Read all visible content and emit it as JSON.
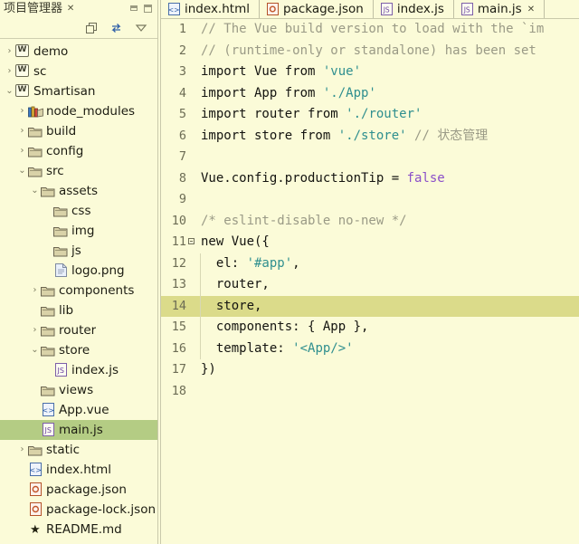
{
  "left_panel": {
    "tab_label": "项目管理器",
    "tab_close": "✕",
    "window_buttons": {
      "minimize": "minimize-icon",
      "maximize": "maximize-icon"
    },
    "toolbar": {
      "collapse_all": "collapse-all-icon",
      "link_with_editor": "link-with-editor-icon",
      "view_menu": "view-menu-icon"
    },
    "tree": [
      {
        "label": "demo",
        "indent": 0,
        "twisty": "›",
        "icon": "project-icon",
        "icon_text": "W",
        "selected": false
      },
      {
        "label": "sc",
        "indent": 0,
        "twisty": "›",
        "icon": "project-icon",
        "icon_text": "W",
        "selected": false
      },
      {
        "label": "Smartisan",
        "indent": 0,
        "twisty": "⌄",
        "icon": "project-icon",
        "icon_text": "W",
        "selected": false
      },
      {
        "label": "node_modules",
        "indent": 1,
        "twisty": "›",
        "icon": "books-icon",
        "icon_text": "",
        "selected": false
      },
      {
        "label": "build",
        "indent": 1,
        "twisty": "›",
        "icon": "folder-icon",
        "icon_text": "",
        "selected": false
      },
      {
        "label": "config",
        "indent": 1,
        "twisty": "›",
        "icon": "folder-icon",
        "icon_text": "",
        "selected": false
      },
      {
        "label": "src",
        "indent": 1,
        "twisty": "⌄",
        "icon": "folder-icon",
        "icon_text": "",
        "selected": false
      },
      {
        "label": "assets",
        "indent": 2,
        "twisty": "⌄",
        "icon": "folder-icon",
        "icon_text": "",
        "selected": false
      },
      {
        "label": "css",
        "indent": 3,
        "twisty": "",
        "icon": "folder-icon",
        "icon_text": "",
        "selected": false
      },
      {
        "label": "img",
        "indent": 3,
        "twisty": "",
        "icon": "folder-icon",
        "icon_text": "",
        "selected": false
      },
      {
        "label": "js",
        "indent": 3,
        "twisty": "",
        "icon": "folder-icon",
        "icon_text": "",
        "selected": false
      },
      {
        "label": "logo.png",
        "indent": 3,
        "twisty": "",
        "icon": "file-icon",
        "icon_text": "",
        "selected": false
      },
      {
        "label": "components",
        "indent": 2,
        "twisty": "›",
        "icon": "folder-icon",
        "icon_text": "",
        "selected": false
      },
      {
        "label": "lib",
        "indent": 2,
        "twisty": "",
        "icon": "folder-icon",
        "icon_text": "",
        "selected": false
      },
      {
        "label": "router",
        "indent": 2,
        "twisty": "›",
        "icon": "folder-icon",
        "icon_text": "",
        "selected": false
      },
      {
        "label": "store",
        "indent": 2,
        "twisty": "⌄",
        "icon": "folder-icon",
        "icon_text": "",
        "selected": false
      },
      {
        "label": "index.js",
        "indent": 3,
        "twisty": "",
        "icon": "js-icon",
        "icon_text": "",
        "selected": false
      },
      {
        "label": "views",
        "indent": 2,
        "twisty": "",
        "icon": "folder-icon",
        "icon_text": "",
        "selected": false
      },
      {
        "label": "App.vue",
        "indent": 2,
        "twisty": "",
        "icon": "vue-icon",
        "icon_text": "",
        "selected": false
      },
      {
        "label": "main.js",
        "indent": 2,
        "twisty": "",
        "icon": "js-icon",
        "icon_text": "",
        "selected": true
      },
      {
        "label": "static",
        "indent": 1,
        "twisty": "›",
        "icon": "folder-icon",
        "icon_text": "",
        "selected": false
      },
      {
        "label": "index.html",
        "indent": 1,
        "twisty": "",
        "icon": "html-icon",
        "icon_text": "",
        "selected": false
      },
      {
        "label": "package.json",
        "indent": 1,
        "twisty": "",
        "icon": "json-icon",
        "icon_text": "",
        "selected": false
      },
      {
        "label": "package-lock.json",
        "indent": 1,
        "twisty": "",
        "icon": "json-icon",
        "icon_text": "",
        "selected": false
      },
      {
        "label": "README.md",
        "indent": 1,
        "twisty": "",
        "icon": "star-icon",
        "icon_text": "★",
        "selected": false
      }
    ]
  },
  "editor": {
    "tabs": [
      {
        "label": "index.html",
        "icon": "html-icon",
        "active": false,
        "close": ""
      },
      {
        "label": "package.json",
        "icon": "json-icon",
        "active": false,
        "close": ""
      },
      {
        "label": "index.js",
        "icon": "js-icon",
        "active": false,
        "close": ""
      },
      {
        "label": "main.js",
        "icon": "js-icon",
        "active": true,
        "close": "✕"
      }
    ],
    "highlight_line": 14,
    "lines": [
      {
        "n": "1",
        "fold": false,
        "text": "// The Vue build version to load with the `im",
        "cls": "c-comment"
      },
      {
        "n": "2",
        "fold": false,
        "text": "// (runtime-only or standalone) has been set",
        "cls": "c-comment"
      },
      {
        "n": "3",
        "fold": false,
        "text": "import Vue from 'vue'",
        "cls": "mix-import-vue"
      },
      {
        "n": "4",
        "fold": false,
        "text": "import App from './App'",
        "cls": "mix-import-app"
      },
      {
        "n": "5",
        "fold": false,
        "text": "import router from './router'",
        "cls": "mix-import-router"
      },
      {
        "n": "6",
        "fold": false,
        "text": "import store from './store' // 状态管理",
        "cls": "mix-import-store"
      },
      {
        "n": "7",
        "fold": false,
        "text": "",
        "cls": "c-plain"
      },
      {
        "n": "8",
        "fold": false,
        "text": "Vue.config.productionTip = false",
        "cls": "mix-config"
      },
      {
        "n": "9",
        "fold": false,
        "text": "",
        "cls": "c-plain"
      },
      {
        "n": "10",
        "fold": false,
        "text": "/* eslint-disable no-new */",
        "cls": "c-comment"
      },
      {
        "n": "11",
        "fold": true,
        "text": "new Vue({",
        "cls": "c-plain"
      },
      {
        "n": "12",
        "fold": false,
        "text": "  el: '#app',",
        "cls": "mix-el"
      },
      {
        "n": "13",
        "fold": false,
        "text": "  router,",
        "cls": "c-plain"
      },
      {
        "n": "14",
        "fold": false,
        "text": "  store,",
        "cls": "c-plain"
      },
      {
        "n": "15",
        "fold": false,
        "text": "  components: { App },",
        "cls": "c-plain"
      },
      {
        "n": "16",
        "fold": false,
        "text": "  template: '<App/>'",
        "cls": "mix-template"
      },
      {
        "n": "17",
        "fold": false,
        "text": "})",
        "cls": "c-plain"
      },
      {
        "n": "18",
        "fold": false,
        "text": "",
        "cls": "c-plain"
      }
    ],
    "code_tokens": [
      [
        {
          "t": "// The Vue build version to load with the `im",
          "c": "c-comment"
        }
      ],
      [
        {
          "t": "// (runtime-only or standalone) has been set",
          "c": "c-comment"
        }
      ],
      [
        {
          "t": "import Vue from ",
          "c": "c-plain"
        },
        {
          "t": "'vue'",
          "c": "c-string"
        }
      ],
      [
        {
          "t": "import App from ",
          "c": "c-plain"
        },
        {
          "t": "'./App'",
          "c": "c-string"
        }
      ],
      [
        {
          "t": "import router from ",
          "c": "c-plain"
        },
        {
          "t": "'./router'",
          "c": "c-string"
        }
      ],
      [
        {
          "t": "import store from ",
          "c": "c-plain"
        },
        {
          "t": "'./store'",
          "c": "c-string"
        },
        {
          "t": " ",
          "c": "c-plain"
        },
        {
          "t": "// ",
          "c": "c-comment"
        },
        {
          "t": "状态管理",
          "c": "c-cjk"
        }
      ],
      [
        {
          "t": "",
          "c": "c-plain"
        }
      ],
      [
        {
          "t": "Vue.config.productionTip = ",
          "c": "c-plain"
        },
        {
          "t": "false",
          "c": "c-bool"
        }
      ],
      [
        {
          "t": "",
          "c": "c-plain"
        }
      ],
      [
        {
          "t": "/* eslint-disable no-new */",
          "c": "c-comment"
        }
      ],
      [
        {
          "t": "new Vue({",
          "c": "c-plain"
        }
      ],
      [
        {
          "t": "  el: ",
          "c": "c-plain"
        },
        {
          "t": "'#app'",
          "c": "c-string"
        },
        {
          "t": ",",
          "c": "c-plain"
        }
      ],
      [
        {
          "t": "  router,",
          "c": "c-plain"
        }
      ],
      [
        {
          "t": "  store,",
          "c": "c-plain"
        }
      ],
      [
        {
          "t": "  components: { App },",
          "c": "c-plain"
        }
      ],
      [
        {
          "t": "  template: ",
          "c": "c-plain"
        },
        {
          "t": "'<App/>'",
          "c": "c-string"
        }
      ],
      [
        {
          "t": "})",
          "c": "c-plain"
        }
      ],
      [
        {
          "t": "",
          "c": "c-plain"
        }
      ]
    ]
  },
  "colors": {
    "background": "#fbfbd8",
    "selection_green": "#b4cc84",
    "highlight_line": "#dbdb8a",
    "comment": "#9a9a86",
    "string": "#2f8f8f",
    "boolean": "#8b4fc9",
    "border": "#c9c9ab"
  }
}
